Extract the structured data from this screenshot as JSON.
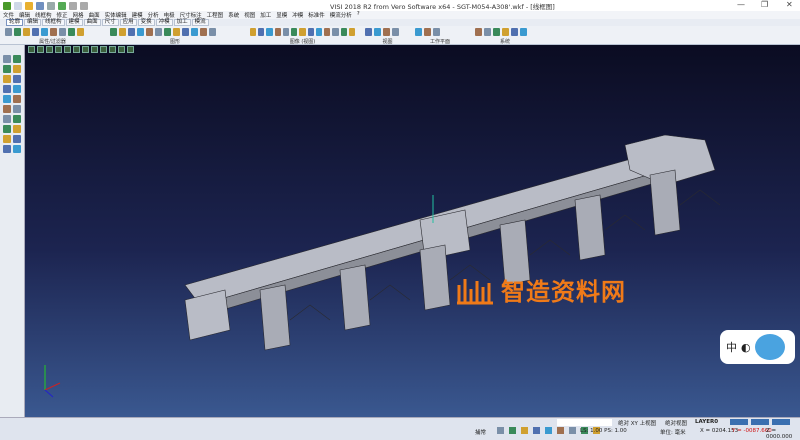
{
  "title": "VISI 2018 R2 from Vero Software x64 - SGT-M054-A308'.wkf - [线框图]",
  "window_controls": {
    "minimize": "—",
    "maximize": "❐",
    "close": "✕"
  },
  "menu": [
    "文件",
    "编辑",
    "线框构",
    "修正",
    "网格",
    "曲面",
    "实体编辑",
    "建模",
    "分析",
    "电极",
    "尺寸标注",
    "工程图",
    "系统",
    "视图",
    "加工",
    "显模",
    "冲模",
    "标准件",
    "模流分析",
    "?"
  ],
  "tabs": [
    "轮廓",
    "编辑",
    "线框构",
    "建模",
    "曲面",
    "尺寸",
    "应用",
    "变换",
    "冲模",
    "加工",
    "模流"
  ],
  "active_tab": "轮廓",
  "ribbon_groups": [
    {
      "label": "属性/过滤器",
      "icons": 9
    },
    {
      "label": "图形",
      "icons": 12
    },
    {
      "label": "图像 (视图)",
      "icons": 13
    },
    {
      "label": "视图",
      "icons": 4
    },
    {
      "label": "工作平面",
      "icons": 3
    },
    {
      "label": "系统",
      "icons": 6
    }
  ],
  "watermark": "智造资料网",
  "ime": {
    "label": "中",
    "extra": "◐"
  },
  "status": {
    "mode": "捕常",
    "view": "绝对 XY 上视图",
    "abs_view": "绝对视图",
    "layer": "LAYER0",
    "scale": "LS: 1.00 PS: 1.00",
    "units": "单位: 毫米",
    "x": "X = 0204.153",
    "y": "Y = -0087.660",
    "z": "Z = 0000.000"
  },
  "colors": {
    "accent": "#f07a18",
    "viewport_top": "#0b0c22",
    "viewport_bottom": "#3a5890",
    "y_coord": "#d01010"
  }
}
